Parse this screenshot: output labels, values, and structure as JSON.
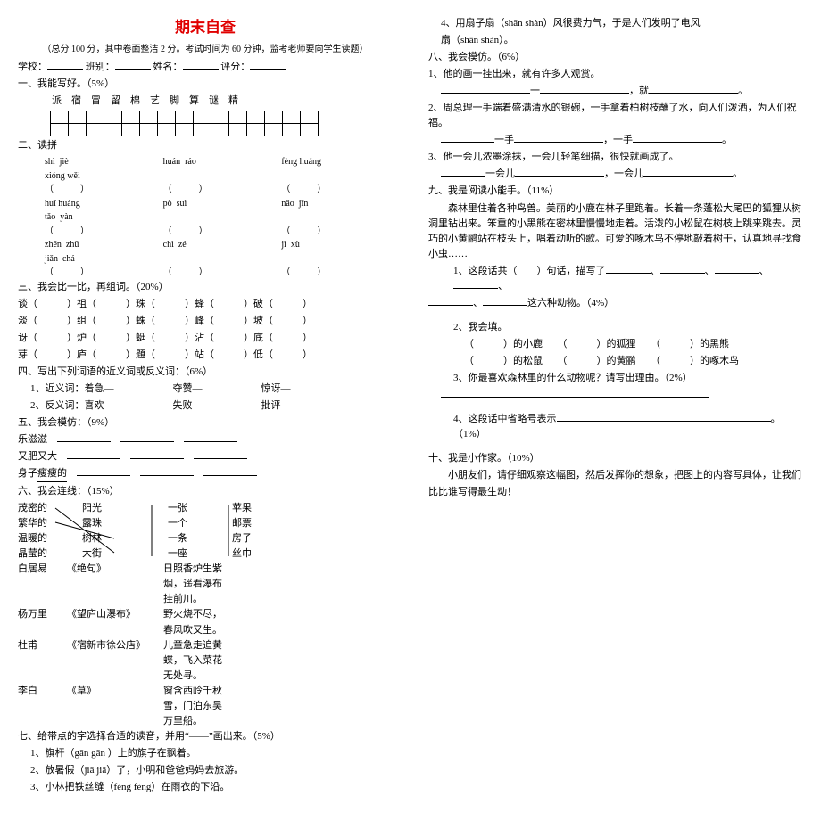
{
  "title": "期末自查",
  "subheader": "（总分 100 分，其中卷面整洁 2 分。考试时间为 60 分钟，监考老师要向学生读题）",
  "labels": {
    "school": "学校：",
    "class": "班别：",
    "name": "姓名：",
    "score": "评分："
  },
  "q1": {
    "h": "一、我能写好。（5%）",
    "chars": "派　宿　冒　留　棉　艺　脚　算　谜　精"
  },
  "q2": {
    "h": "二、读拼",
    "r1a": "shì  jiè",
    "r1b": "huán  ráo",
    "r1c": "fèng huáng",
    "r1d": "xióng wěi",
    "r2a": "huī huáng",
    "r2b": "pò  suì",
    "r2c": "nǎo  jīn",
    "r2d": "tǎo  yàn",
    "r3a": "zhēn  zhū",
    "r3b": "chì  zé",
    "r3c": "jì  xù",
    "r3d": "jiǎn  chá",
    "par": "（　　　）"
  },
  "q3": {
    "h": "三、我会比一比，再组词。（20%）",
    "l": [
      "谈（　　　）祖（　　　）珠（　　　）蜂（　　　）破（　　　）",
      "淡（　　　）组（　　　）蛛（　　　）峰（　　　）坡（　　　）",
      "讶（　　　）炉（　　　）蜓（　　　）沾（　　　）底（　　　）",
      "芽（　　　）庐（　　　）題（　　　）站（　　　）低（　　　）"
    ]
  },
  "q4": {
    "h": "四、写出下列词语的近义词或反义词：（6%）",
    "l1": "1、近义词：着急—　　　　　　夺赞—　　　　　　惊讶—　　　　　　",
    "l2": "2、反义词：喜欢—　　　　　　失败—　　　　　　批评—　　　　　　"
  },
  "q5": {
    "h": "五、我会模仿：（9%）",
    "l1": "乐滋滋",
    "l2": "又肥又大",
    "l3u": "瘦瘦的",
    "l3a": "身子"
  },
  "q6": {
    "h": "六、我会连线：（15%）",
    "a": [
      "茂密的",
      "繁华的",
      "温暖的",
      "晶莹的"
    ],
    "b": [
      "阳光",
      "露珠",
      "树林",
      "大街"
    ],
    "c": [
      "一张",
      "一个",
      "一条",
      "一座"
    ],
    "d": [
      "苹果",
      "邮票",
      "房子",
      "丝巾"
    ],
    "p1": [
      "白居易",
      "《绝句》",
      "日照香炉生紫烟，遥看瀑布挂前川。"
    ],
    "p2": [
      "杨万里",
      "《望庐山瀑布》",
      "野火烧不尽，春风吹又生。"
    ],
    "p3": [
      "杜甫",
      "《宿新市徐公店》",
      "儿童急走追黄蝶，飞入菜花无处寻。"
    ],
    "p4": [
      "李白",
      "《草》",
      "窗含西岭千秋雪，门泊东吴万里船。"
    ]
  },
  "q7": {
    "h": "七、给带点的字选择合适的读音，并用“——”画出来。（5%）",
    "l": [
      "1、旗杆（gān gǎn ）上的旗子在飘着。",
      "2、放暑假（jiǎ jiǎ）了，小明和爸爸妈妈去旅游。",
      "3、小林把铁丝缝（féng fèng）在雨衣的下沿。",
      "4、用扇子扇（shān shàn）风很费力气，于是人们发明了电风",
      "扇（shān shàn）。"
    ]
  },
  "q8": {
    "h": "八、我会模仿。（6%）",
    "l1": "1、他的画一挂出来，就有许多人观赏。",
    "l1b": "一",
    "l1c": "，就",
    "l2": "2、周总理一手端着盛满清水的银碗，一手拿着柏树枝蘸了水，向人们泼洒，为人们祝福。",
    "l2b": "一手",
    "l2c": "，一手",
    "l3": "3、他一会儿浓墨涂抹，一会儿轻笔细描，很快就画成了。",
    "l3b": "一会儿",
    "l3c": "，一会儿"
  },
  "q9": {
    "h": "九、我是阅读小能手。（11%）",
    "p": "森林里住着各种鸟兽。美丽的小鹿在林子里跑着。长着一条蓬松大尾巴的狐狸从树洞里钻出来。笨重的小黑熊在密林里慢慢地走着。活泼的小松鼠在树枝上跳来跳去。灵巧的小黄鹂站在枝头上，唱着动听的歌。可爱的啄木鸟不停地敲着树干，认真地寻找食小虫……",
    "q1a": "1、这段话共（　　）句话，描写了",
    "q1b": "这六种动物。（4%）",
    "q2h": "2、我会填。",
    "q2a": "（　　　）的小鹿　　（　　　）的狐狸　　（　　　）的黑熊",
    "q2b": "（　　　）的松鼠　　（　　　）的黄鹂　　（　　　）的啄木鸟",
    "q3": "3、你最喜欢森林里的什么动物呢？请写出理由。（2%）",
    "q4": "4、这段话中省略号表示",
    "q4b": "。（1%）"
  },
  "q10": {
    "h": "十、我是小作家。（10%）",
    "p": "小朋友们，请仔细观察这幅图，然后发挥你的想象，把图上的内容写具体，让我们",
    "p2": "比比谁写得最生动！"
  }
}
